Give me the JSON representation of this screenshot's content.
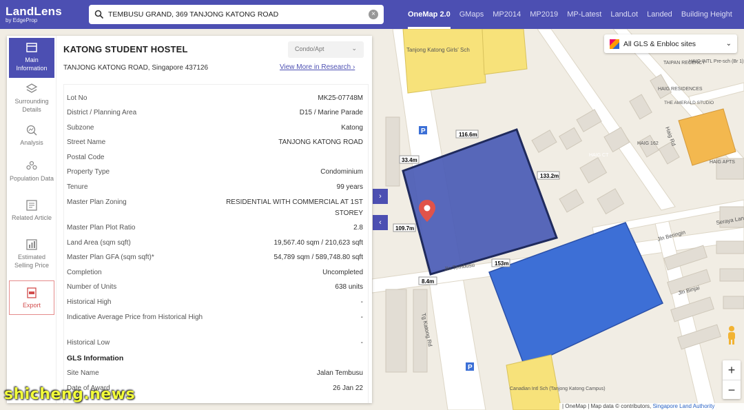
{
  "header": {
    "logo_main": "LandLens",
    "logo_sub": "by EdgeProp",
    "search_value": "TEMBUSU GRAND, 369 TANJONG KATONG ROAD",
    "nav": [
      "OneMap 2.0",
      "GMaps",
      "MP2014",
      "MP2019",
      "MP-Latest",
      "LandLot",
      "Landed",
      "Building Height"
    ],
    "active_nav": "OneMap 2.0"
  },
  "sidebar": {
    "items": [
      {
        "label": "Main Information",
        "icon": "map-icon",
        "active": true
      },
      {
        "label": "Surrounding Details",
        "icon": "layers-icon"
      },
      {
        "label": "Analysis",
        "icon": "analysis-icon"
      },
      {
        "label": "Population Data",
        "icon": "population-icon"
      },
      {
        "label": "Related Article",
        "icon": "article-icon"
      },
      {
        "label": "Estimated Selling Price",
        "icon": "price-chart-icon"
      },
      {
        "label": "Export",
        "icon": "pdf-icon"
      }
    ]
  },
  "property": {
    "title": "KATONG STUDENT HOSTEL",
    "address": "TANJONG KATONG ROAD, Singapore 437126",
    "type_select": "Condo/Apt",
    "more_link": "View More in Research",
    "rows": [
      {
        "k": "Lot No",
        "v": "MK25-07748M"
      },
      {
        "k": "District / Planning Area",
        "v": "D15 / Marine Parade"
      },
      {
        "k": "Subzone",
        "v": "Katong"
      },
      {
        "k": "Street Name",
        "v": "TANJONG KATONG ROAD"
      },
      {
        "k": "Postal Code",
        "v": ""
      },
      {
        "k": "Property Type",
        "v": "Condominium"
      },
      {
        "k": "Tenure",
        "v": "99 years"
      },
      {
        "k": "Master Plan Zoning",
        "v": "RESIDENTIAL WITH COMMERCIAL AT 1ST STOREY"
      },
      {
        "k": "Master Plan Plot Ratio",
        "v": "2.8"
      },
      {
        "k": "Land Area (sqm sqft)",
        "v": "19,567.40 sqm / 210,623 sqft"
      },
      {
        "k": "Master Plan GFA (sqm sqft)*",
        "v": "54,789 sqm / 589,748.80 sqft"
      },
      {
        "k": "Completion",
        "v": "Uncompleted"
      },
      {
        "k": "Number of Units",
        "v": "638 units"
      },
      {
        "k": "Historical High",
        "v": "-"
      },
      {
        "k": "Indicative Average Price from Historical High",
        "v": "-"
      },
      {
        "k": "Historical Low",
        "v": "-"
      }
    ],
    "gls_title": "GLS Information",
    "gls_rows": [
      {
        "k": "Site Name",
        "v": "Jalan Tembusu"
      },
      {
        "k": "Date of Award",
        "v": "26 Jan 22"
      }
    ]
  },
  "map": {
    "gls_filter": "All GLS & Enbloc sites",
    "measurements": [
      "116.6m",
      "133.2m",
      "153m",
      "109.7m",
      "33.4m",
      "8.4m"
    ],
    "roads": [
      "Jln Tembusu",
      "Tg Katong Rd",
      "Jln Beringin",
      "Jln Binjai",
      "Seraya Lane",
      "Haig Rd"
    ],
    "places": [
      "Tanjong Katong Girls' Sch",
      "TAIPAN REGENCY",
      "HAIG INTL Pre-sch (Br 1)",
      "HAIG RESIDENCES",
      "THE AMERALD STUDIO",
      "HAIG CT",
      "HAIG 162",
      "HAIG APTS",
      "Canadian Intl Sch (Tanjong Katong Campus)"
    ],
    "attribution": "| OneMap | Map data © contributors,",
    "attribution_link": "Singapore Land Authority",
    "zoom_in": "+",
    "zoom_out": "−",
    "colors": {
      "site": "#4a5bb5",
      "site_border": "#1f2a5c",
      "gls": "#3d6fd6",
      "school": "#f7e27a",
      "orange": "#f3b84f"
    }
  },
  "watermark": "shicheng.news"
}
